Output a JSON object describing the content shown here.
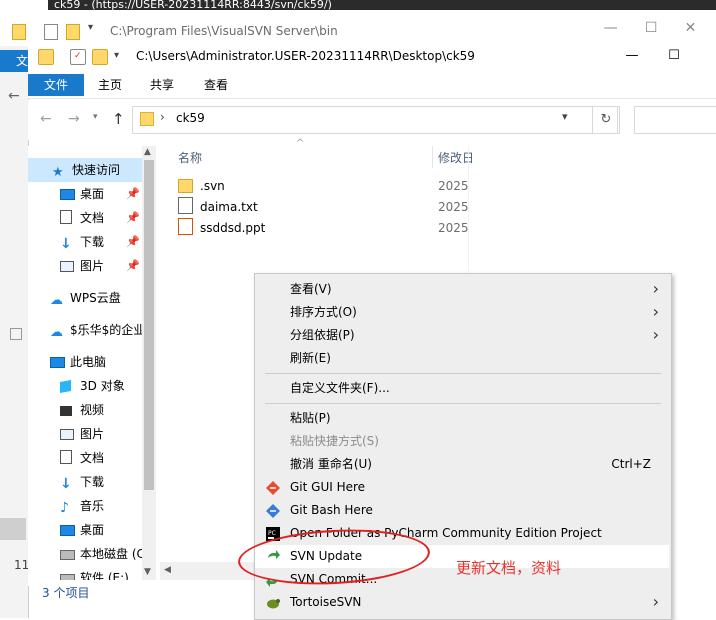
{
  "background_window": {
    "title_fragment": "ck59 - (https://USER-20231114RR:8443/svn/ck59/)",
    "path": "C:\\Program Files\\VisualSVN Server\\bin",
    "file_tab": "文",
    "left_number": "11"
  },
  "window": {
    "path": "C:\\Users\\Administrator.USER-20231114RR\\Desktop\\ck59",
    "minimize": "—",
    "maximize": "☐"
  },
  "ribbon": {
    "file": "文件",
    "tabs": [
      "主页",
      "共享",
      "查看"
    ]
  },
  "address": {
    "folder": "ck59"
  },
  "sidebar": {
    "items": [
      {
        "label": "快速访问",
        "icon": "star-icon",
        "color": "#1f78d1"
      },
      {
        "label": "桌面",
        "icon": "desktop-icon",
        "color": "#1e88e5",
        "pinned": true
      },
      {
        "label": "文档",
        "icon": "document-icon",
        "color": "#555555",
        "pinned": true
      },
      {
        "label": "下载",
        "icon": "download-icon",
        "color": "#1e88e5",
        "pinned": true
      },
      {
        "label": "图片",
        "icon": "pictures-icon",
        "color": "#555555",
        "pinned": true
      },
      {
        "label": "WPS云盘",
        "icon": "cloud-icon",
        "color": "#1e88e5"
      },
      {
        "label": "$乐华$的企业",
        "icon": "cloud-icon",
        "color": "#1e88e5"
      },
      {
        "label": "此电脑",
        "icon": "computer-icon",
        "color": "#1e88e5"
      },
      {
        "label": "3D 对象",
        "icon": "cube-icon",
        "color": "#29b6f6"
      },
      {
        "label": "视频",
        "icon": "video-icon",
        "color": "#333333"
      },
      {
        "label": "图片",
        "icon": "pictures-icon",
        "color": "#555555"
      },
      {
        "label": "文档",
        "icon": "document-icon",
        "color": "#555555"
      },
      {
        "label": "下载",
        "icon": "download-icon",
        "color": "#1e88e5"
      },
      {
        "label": "音乐",
        "icon": "music-icon",
        "color": "#1e88e5"
      },
      {
        "label": "桌面",
        "icon": "desktop-icon",
        "color": "#1e88e5"
      },
      {
        "label": "本地磁盘 (C",
        "icon": "disk-icon",
        "color": "#666666"
      },
      {
        "label": "软件 (E:)",
        "icon": "disk-icon",
        "color": "#666666"
      }
    ]
  },
  "file_list": {
    "col_name": "名称",
    "col_date": "修改日",
    "files": [
      {
        "name": ".svn",
        "date": "2025",
        "icon": "folder-icon"
      },
      {
        "name": "daima.txt",
        "date": "2025",
        "icon": "text-file-icon"
      },
      {
        "name": "ssddsd.ppt",
        "date": "2025",
        "icon": "ppt-file-icon"
      }
    ]
  },
  "status": {
    "count": "3 个项目"
  },
  "context_menu": {
    "items": [
      {
        "label": "查看(V)",
        "submenu": true
      },
      {
        "label": "排序方式(O)",
        "submenu": true
      },
      {
        "label": "分组依据(P)",
        "submenu": true
      },
      {
        "label": "刷新(E)"
      },
      {
        "separator": true
      },
      {
        "label": "自定义文件夹(F)..."
      },
      {
        "separator": true
      },
      {
        "label": "粘贴(P)"
      },
      {
        "label": "粘贴快捷方式(S)",
        "disabled": true
      },
      {
        "label": "撤消 重命名(U)",
        "shortcut": "Ctrl+Z"
      },
      {
        "label": "Git GUI Here",
        "icon": "git-gui-icon"
      },
      {
        "label": "Git Bash Here",
        "icon": "git-bash-icon"
      },
      {
        "label": "Open Folder as PyCharm Community Edition Project",
        "icon": "pycharm-icon"
      },
      {
        "label": "SVN Update",
        "icon": "svn-update-icon",
        "highlight": true
      },
      {
        "label": "SVN Commit...",
        "icon": "svn-commit-icon"
      },
      {
        "label": "TortoiseSVN",
        "icon": "tortoisesvn-icon",
        "submenu": true
      }
    ]
  },
  "annotation": {
    "text": "更新文档，资料",
    "color": "#e02020"
  }
}
